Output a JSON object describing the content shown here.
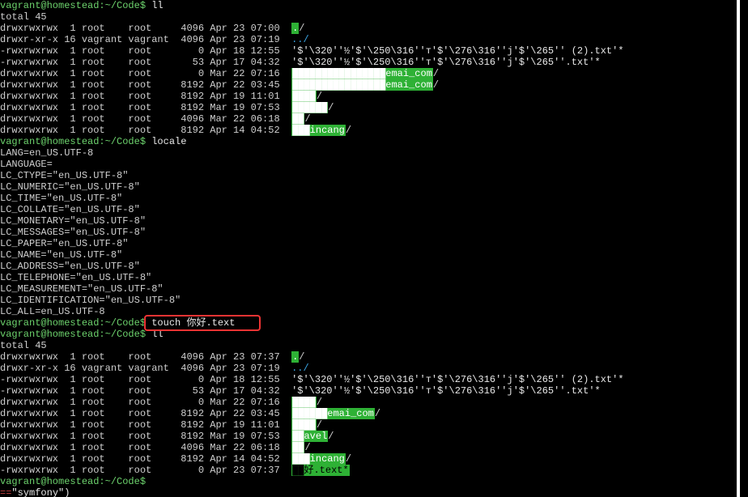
{
  "prompt_path": "vagrant@homestead:~/Code$",
  "cmd_ll": "ll",
  "cmd_locale": "locale",
  "cmd_touch": "touch 你好.text",
  "total": "total 45",
  "ls1": [
    {
      "perm": "drwxrwxrwx",
      "ln": "1",
      "own": "root",
      "grp": "root",
      "size": "4096",
      "date": "Apr 23 07:00",
      "name": "./",
      "cls": "hldir"
    },
    {
      "perm": "drwxr-xr-x",
      "ln": "16",
      "own": "vagrant",
      "grp": "vagrant",
      "size": "4096",
      "date": "Apr 23 07:19",
      "name": "../",
      "cls": "folder"
    },
    {
      "perm": "-rwxrwxrwx",
      "ln": "1",
      "own": "root",
      "grp": "root",
      "size": "0",
      "date": "Apr 18 12:55",
      "name": "'$'\\320''½'$'\\250\\316''т'$'\\276\\316''j'$'\\265'' (2).txt'*",
      "cls": "plain"
    },
    {
      "perm": "-rwxrwxrwx",
      "ln": "1",
      "own": "root",
      "grp": "root",
      "size": "53",
      "date": "Apr 17 04:32",
      "name": "'$'\\320''½'$'\\250\\316''т'$'\\276\\316''j'$'\\265''.txt'*",
      "cls": "plain"
    },
    {
      "perm": "drwxrwxrwx",
      "ln": "1",
      "own": "root",
      "grp": "root",
      "size": "0",
      "date": "Mar 22 07:16",
      "name": "emai_com/",
      "cls": "hldir",
      "prefix": "████████████████"
    },
    {
      "perm": "drwxrwxrwx",
      "ln": "1",
      "own": "root",
      "grp": "root",
      "size": "8192",
      "date": "Apr 22 03:45",
      "name": "emai_com/",
      "cls": "hldir",
      "prefix": "████████████████"
    },
    {
      "perm": "drwxrwxrwx",
      "ln": "1",
      "own": "root",
      "grp": "root",
      "size": "8192",
      "date": "Apr 19 11:01",
      "name": "████/",
      "cls": "hldir"
    },
    {
      "perm": "drwxrwxrwx",
      "ln": "1",
      "own": "root",
      "grp": "root",
      "size": "8192",
      "date": "Mar 19 07:53",
      "name": "██████/",
      "cls": "hldir"
    },
    {
      "perm": "drwxrwxrwx",
      "ln": "1",
      "own": "root",
      "grp": "root",
      "size": "4096",
      "date": "Mar 22 06:18",
      "name": "██/",
      "cls": "hldir"
    },
    {
      "perm": "drwxrwxrwx",
      "ln": "1",
      "own": "root",
      "grp": "root",
      "size": "8192",
      "date": "Apr 14 04:52",
      "name": "███incang/",
      "cls": "hldir"
    }
  ],
  "locale_out": [
    "LANG=en_US.UTF-8",
    "LANGUAGE=",
    "LC_CTYPE=\"en_US.UTF-8\"",
    "LC_NUMERIC=\"en_US.UTF-8\"",
    "LC_TIME=\"en_US.UTF-8\"",
    "LC_COLLATE=\"en_US.UTF-8\"",
    "LC_MONETARY=\"en_US.UTF-8\"",
    "LC_MESSAGES=\"en_US.UTF-8\"",
    "LC_PAPER=\"en_US.UTF-8\"",
    "LC_NAME=\"en_US.UTF-8\"",
    "LC_ADDRESS=\"en_US.UTF-8\"",
    "LC_TELEPHONE=\"en_US.UTF-8\"",
    "LC_MEASUREMENT=\"en_US.UTF-8\"",
    "LC_IDENTIFICATION=\"en_US.UTF-8\"",
    "LC_ALL=en_US.UTF-8"
  ],
  "ls2": [
    {
      "perm": "drwxrwxrwx",
      "ln": "1",
      "own": "root",
      "grp": "root",
      "size": "4096",
      "date": "Apr 23 07:37",
      "name": "./",
      "cls": "hldir"
    },
    {
      "perm": "drwxr-xr-x",
      "ln": "16",
      "own": "vagrant",
      "grp": "vagrant",
      "size": "4096",
      "date": "Apr 23 07:19",
      "name": "../",
      "cls": "folder"
    },
    {
      "perm": "-rwxrwxrwx",
      "ln": "1",
      "own": "root",
      "grp": "root",
      "size": "0",
      "date": "Apr 18 12:55",
      "name": "'$'\\320''½'$'\\250\\316''т'$'\\276\\316''j'$'\\265'' (2).txt'*",
      "cls": "plain"
    },
    {
      "perm": "-rwxrwxrwx",
      "ln": "1",
      "own": "root",
      "grp": "root",
      "size": "53",
      "date": "Apr 17 04:32",
      "name": "'$'\\320''½'$'\\250\\316''т'$'\\276\\316''j'$'\\265''.txt'*",
      "cls": "plain"
    },
    {
      "perm": "drwxrwxrwx",
      "ln": "1",
      "own": "root",
      "grp": "root",
      "size": "0",
      "date": "Mar 22 07:16",
      "name": "████/",
      "cls": "hldir"
    },
    {
      "perm": "drwxrwxrwx",
      "ln": "1",
      "own": "root",
      "grp": "root",
      "size": "8192",
      "date": "Apr 22 03:45",
      "name": "██████emai_com/",
      "cls": "hldir"
    },
    {
      "perm": "drwxrwxrwx",
      "ln": "1",
      "own": "root",
      "grp": "root",
      "size": "8192",
      "date": "Apr 19 11:01",
      "name": "████/",
      "cls": "hldir"
    },
    {
      "perm": "drwxrwxrwx",
      "ln": "1",
      "own": "root",
      "grp": "root",
      "size": "8192",
      "date": "Mar 19 07:53",
      "name": "██avel/",
      "cls": "hldir"
    },
    {
      "perm": "drwxrwxrwx",
      "ln": "1",
      "own": "root",
      "grp": "root",
      "size": "4096",
      "date": "Mar 22 06:18",
      "name": "██/",
      "cls": "hldir"
    },
    {
      "perm": "drwxrwxrwx",
      "ln": "1",
      "own": "root",
      "grp": "root",
      "size": "8192",
      "date": "Apr 14 04:52",
      "name": "███incang/",
      "cls": "hldir"
    },
    {
      "perm": "-rwxrwxrwx",
      "ln": "1",
      "own": "root",
      "grp": "root",
      "size": "0",
      "date": "Apr 23 07:37",
      "name": "██好.text*",
      "cls": "hlfile"
    }
  ],
  "bottom_hint": "\"symfony\")"
}
